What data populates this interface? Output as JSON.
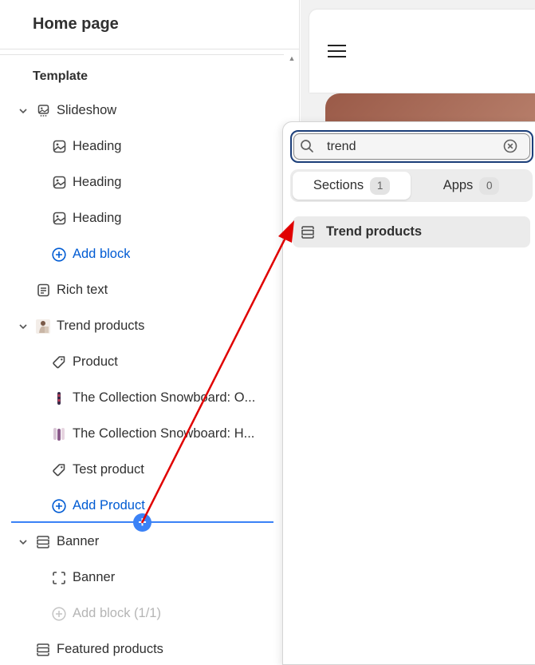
{
  "sidebar": {
    "title": "Home page",
    "section_label": "Template",
    "items": [
      {
        "label": "Slideshow",
        "icon": "slideshow-icon"
      },
      {
        "label": "Heading",
        "icon": "image-icon"
      },
      {
        "label": "Heading",
        "icon": "image-icon"
      },
      {
        "label": "Heading",
        "icon": "image-icon"
      },
      {
        "label": "Add block",
        "icon": "plus-circle-icon"
      },
      {
        "label": "Rich text",
        "icon": "text-icon"
      },
      {
        "label": "Trend products",
        "icon": "product-thumbnail"
      },
      {
        "label": "Product",
        "icon": "tag-icon"
      },
      {
        "label": "The Collection Snowboard: O...",
        "icon": "snowboard-thumbnail"
      },
      {
        "label": "The Collection Snowboard: H...",
        "icon": "snowboard-thumbnail"
      },
      {
        "label": "Test product",
        "icon": "tag-icon"
      },
      {
        "label": "Add Product",
        "icon": "plus-circle-icon"
      },
      {
        "label": "Banner",
        "icon": "section-icon"
      },
      {
        "label": "Banner",
        "icon": "banner-block-icon"
      },
      {
        "label": "Add block (1/1)",
        "icon": "plus-circle-icon"
      },
      {
        "label": "Featured products",
        "icon": "section-icon"
      }
    ]
  },
  "popup": {
    "search": {
      "value": "trend",
      "placeholder": "Search sections"
    },
    "tabs": [
      {
        "label": "Sections",
        "count": "1"
      },
      {
        "label": "Apps",
        "count": "0"
      }
    ],
    "results": [
      {
        "label": "Trend products",
        "icon": "section-icon"
      }
    ]
  },
  "colors": {
    "accent_blue": "#005bd3",
    "insert_line": "#3b82f6",
    "arrow": "#e00000",
    "focus_border": "#1c3f7a"
  }
}
